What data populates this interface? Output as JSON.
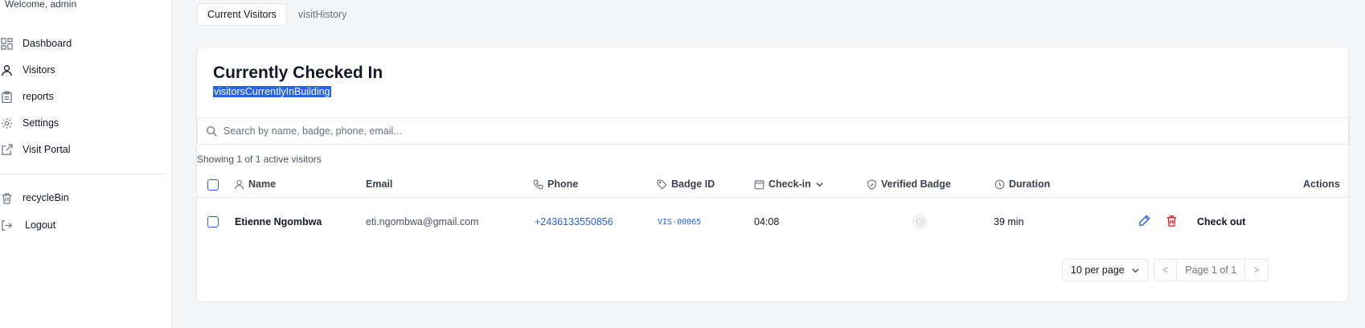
{
  "sidebar": {
    "welcome": "Welcome, admin",
    "items": [
      {
        "label": "Dashboard",
        "icon": "dashboard-grid-icon"
      },
      {
        "label": "Visitors",
        "icon": "user-icon"
      },
      {
        "label": "reports",
        "icon": "clipboard-icon"
      },
      {
        "label": "Settings",
        "icon": "gear-icon"
      },
      {
        "label": "Visit Portal",
        "icon": "external-link-icon"
      },
      {
        "label": "recycleBin",
        "icon": "trash-icon"
      },
      {
        "label": "Logout",
        "icon": "logout-icon"
      }
    ]
  },
  "tabs": [
    {
      "label": "Current Visitors",
      "active": true
    },
    {
      "label": "visitHistory",
      "active": false
    }
  ],
  "card": {
    "title": "Currently Checked In",
    "subtitle": "visitorsCurrentlyInBuilding"
  },
  "search": {
    "placeholder": "Search by name, badge, phone, email...",
    "value": ""
  },
  "showing": "Showing 1 of 1 active visitors",
  "table": {
    "columns": [
      "Name",
      "Email",
      "Phone",
      "Badge ID",
      "Check-in",
      "Verified Badge",
      "Duration",
      "Actions"
    ],
    "rows": [
      {
        "name": "Etienne Ngombwa",
        "email": "eti.ngombwa@gmail.com",
        "phone": "+2436133550856",
        "badge_id": "VIS-00065",
        "check_in": "04:08",
        "verified": false,
        "duration": "39 min",
        "checkout_label": "Check out"
      }
    ]
  },
  "pagination": {
    "per_page": "10 per page",
    "prev": "<",
    "page_label": "Page 1 of 1",
    "next": ">"
  },
  "colors": {
    "accent": "#2563eb",
    "danger": "#dc2626"
  }
}
